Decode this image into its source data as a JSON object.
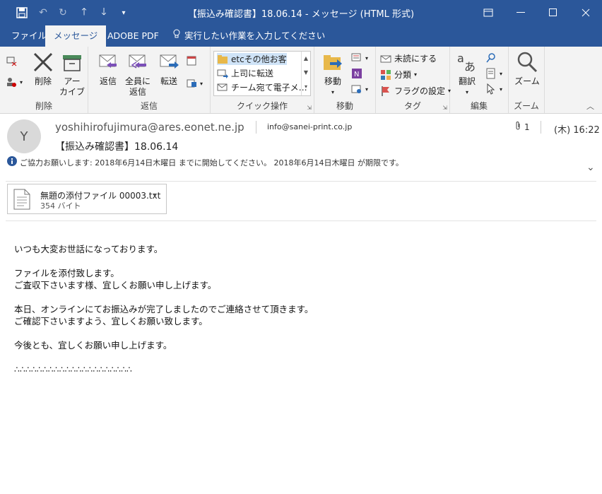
{
  "window": {
    "title": "【振込み確認書】18.06.14  -  メッセージ (HTML 形式)",
    "qat_icons": [
      "save-icon",
      "undo-icon",
      "redo-icon",
      "up-icon",
      "down-icon",
      "customize-icon"
    ],
    "controls": [
      "restore-icon",
      "minimize-icon",
      "maximize-icon",
      "close-icon"
    ]
  },
  "tabs": [
    {
      "label": "ファイル"
    },
    {
      "label": "メッセージ"
    },
    {
      "label": "ADOBE PDF"
    },
    {
      "label": "実行したい作業を入力してください"
    }
  ],
  "ribbon": {
    "delete_group": {
      "label": "削除",
      "delete": "削除",
      "archive_1": "アー",
      "archive_2": "カイブ"
    },
    "respond_group": {
      "label": "返信",
      "reply": "返信",
      "reply_all_1": "全員に",
      "reply_all_2": "返信",
      "forward": "転送"
    },
    "quick_group": {
      "label": "クイック操作",
      "items": [
        "etcその他お客",
        "上司に転送",
        "チーム宛て電子メ…"
      ]
    },
    "move_group": {
      "label": "移動",
      "move": "移動"
    },
    "tags_group": {
      "label": "タグ",
      "unread": "未読にする",
      "categorize": "分類",
      "flag": "フラグの設定"
    },
    "edit_group": {
      "label": "編集",
      "translate": "翻訳"
    },
    "zoom_group": {
      "label": "ズーム",
      "zoom": "ズーム"
    }
  },
  "message": {
    "avatar_initial": "Y",
    "from": "yoshihirofujimura@ares.eonet.ne.jp",
    "to": "info@sanei-print.co.jp",
    "subject": "【振込み確認書】18.06.14",
    "date": "(木) 16:22",
    "attachment_count": "1",
    "info": "ご協力お願いします:  2018年6月14日木曜日 までに開始してください。 2018年6月14日木曜日 が期限です。"
  },
  "attachment": {
    "name": "無題の添付ファイル 00003.txt",
    "size": "354 バイト"
  },
  "body": {
    "p1": "いつも大変お世話になっております。",
    "p2_l1": "ファイルを添付致します。",
    "p2_l2": "ご査収下さいます様、宜しくお願い申し上げます。",
    "p3_l1": "本日、オンラインにてお振込みが完了しましたのでご連絡させて頂きます。",
    "p3_l2": "ご確認下さいますよう、宜しくお願い致します。",
    "p4": "今後とも、宜しくお願い申し上げます。",
    "p5": "∴∴∴∴∴∴∴∴∴∴∴∴∴∴∴∴∴∴∴∴∴"
  }
}
